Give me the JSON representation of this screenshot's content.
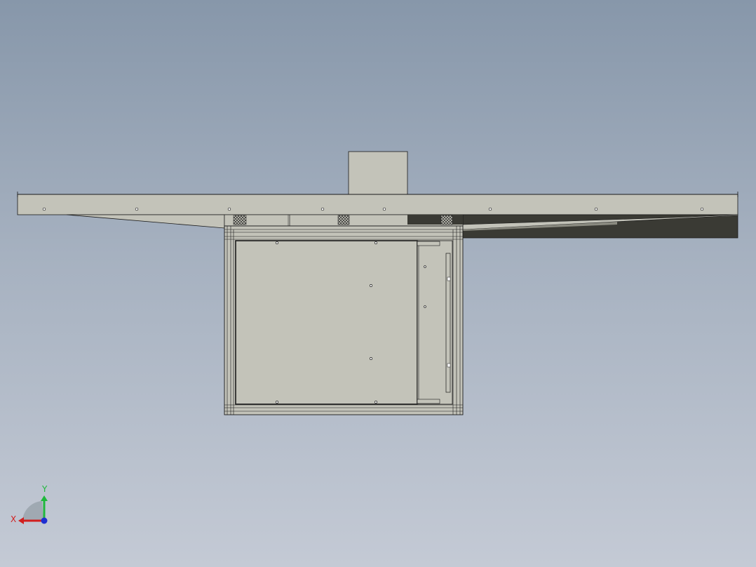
{
  "viewport": {
    "background_top": "#8797aa",
    "background_bottom": "#c4cad5",
    "part_fill": "#c3c3b9",
    "part_shadow_fill": "#3a3a34",
    "edge_color": "#1a1a1a"
  },
  "triad": {
    "x_label": "X",
    "y_label": "Y",
    "x_color": "#d11f1f",
    "y_color": "#1fb83c",
    "z_color": "#1f2fd1",
    "icon": "coordinate-triad-icon"
  }
}
